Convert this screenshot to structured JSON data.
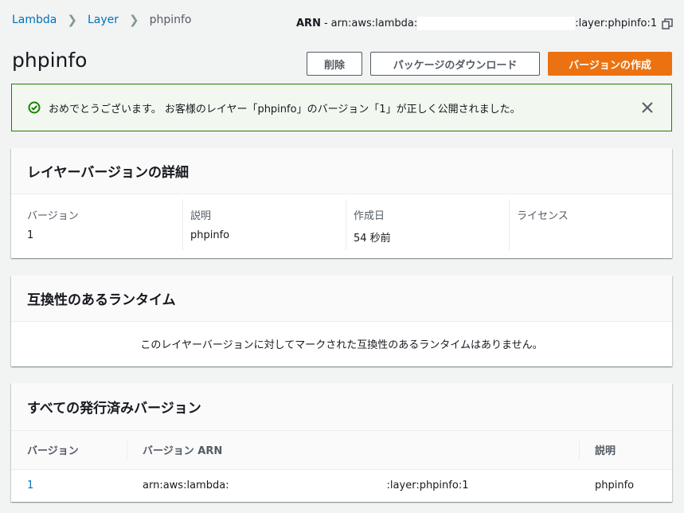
{
  "breadcrumb": {
    "items": [
      "Lambda",
      "Layer",
      "phpinfo"
    ]
  },
  "arn_top": {
    "label": "ARN",
    "separator": "-",
    "prefix": "arn:aws:lambda:",
    "suffix": ":layer:phpinfo:1"
  },
  "page": {
    "title": "phpinfo"
  },
  "buttons": {
    "delete": "削除",
    "download": "パッケージのダウンロード",
    "create_version": "バージョンの作成"
  },
  "flash": {
    "message": "おめでとうございます。 お客様のレイヤー「phpinfo」のバージョン「1」が正しく公開されました。"
  },
  "details_panel": {
    "title": "レイヤーバージョンの詳細",
    "fields": [
      {
        "label": "バージョン",
        "value": "1"
      },
      {
        "label": "説明",
        "value": "phpinfo"
      },
      {
        "label": "作成日",
        "value": "54 秒前"
      },
      {
        "label": "ライセンス",
        "value": ""
      }
    ]
  },
  "runtimes_panel": {
    "title": "互換性のあるランタイム",
    "empty_message": "このレイヤーバージョンに対してマークされた互換性のあるランタイムはありません。"
  },
  "versions_panel": {
    "title": "すべての発行済みバージョン",
    "columns": [
      "バージョン",
      "バージョン ARN",
      "説明"
    ],
    "rows": [
      {
        "version": "1",
        "arn_prefix": "arn:aws:lambda:",
        "arn_suffix": ":layer:phpinfo:1",
        "description": "phpinfo"
      }
    ]
  },
  "colors": {
    "link": "#0073bb",
    "primary": "#ec7211",
    "success": "#1d8102"
  }
}
